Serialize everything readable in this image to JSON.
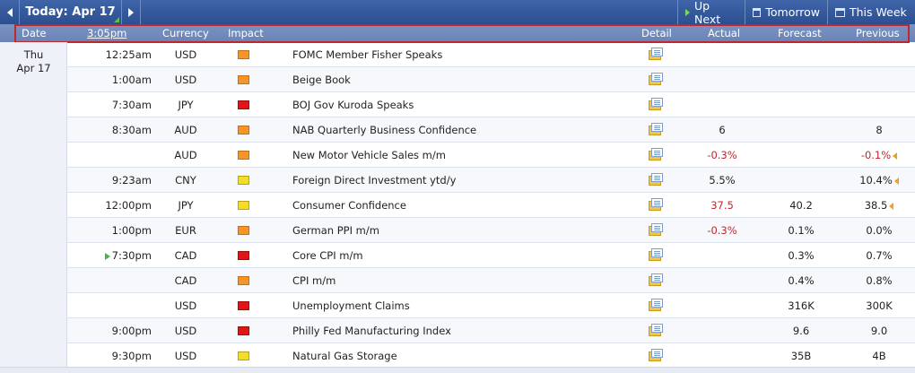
{
  "nav": {
    "today_label": "Today: Apr 17",
    "up_next": "Up Next",
    "tomorrow": "Tomorrow",
    "this_week": "This Week"
  },
  "header": {
    "date": "Date",
    "time": "3:05pm",
    "currency": "Currency",
    "impact": "Impact",
    "detail": "Detail",
    "actual": "Actual",
    "forecast": "Forecast",
    "previous": "Previous"
  },
  "date_group": {
    "weekday": "Thu",
    "date": "Apr 17"
  },
  "colors": {
    "high_impact": "#e01616",
    "medium_impact": "#f5962a",
    "low_impact": "#f5dc2a",
    "negative": "#c0272d",
    "accent": "#2c4f90"
  },
  "events": [
    {
      "time": "12:25am",
      "currency": "USD",
      "impact": "orange",
      "event": "FOMC Member Fisher Speaks",
      "actual": "",
      "forecast": "",
      "previous": ""
    },
    {
      "time": "1:00am",
      "currency": "USD",
      "impact": "orange",
      "event": "Beige Book",
      "actual": "",
      "forecast": "",
      "previous": ""
    },
    {
      "time": "7:30am",
      "currency": "JPY",
      "impact": "red",
      "event": "BOJ Gov Kuroda Speaks",
      "actual": "",
      "forecast": "",
      "previous": ""
    },
    {
      "time": "8:30am",
      "currency": "AUD",
      "impact": "orange",
      "event": "NAB Quarterly Business Confidence",
      "actual": "6",
      "forecast": "",
      "previous": "8"
    },
    {
      "time": "",
      "currency": "AUD",
      "impact": "orange",
      "event": "New Motor Vehicle Sales m/m",
      "actual": "-0.3%",
      "forecast": "",
      "previous": "-0.1%"
    },
    {
      "time": "9:23am",
      "currency": "CNY",
      "impact": "yellow",
      "event": "Foreign Direct Investment ytd/y",
      "actual": "5.5%",
      "forecast": "",
      "previous": "10.4%"
    },
    {
      "time": "12:00pm",
      "currency": "JPY",
      "impact": "yellow",
      "event": "Consumer Confidence",
      "actual": "37.5",
      "forecast": "40.2",
      "previous": "38.5"
    },
    {
      "time": "1:00pm",
      "currency": "EUR",
      "impact": "orange",
      "event": "German PPI m/m",
      "actual": "-0.3%",
      "forecast": "0.1%",
      "previous": "0.0%"
    },
    {
      "time": "7:30pm",
      "currency": "CAD",
      "impact": "red",
      "event": "Core CPI m/m",
      "actual": "",
      "forecast": "0.3%",
      "previous": "0.7%"
    },
    {
      "time": "",
      "currency": "CAD",
      "impact": "orange",
      "event": "CPI m/m",
      "actual": "",
      "forecast": "0.4%",
      "previous": "0.8%"
    },
    {
      "time": "",
      "currency": "USD",
      "impact": "red",
      "event": "Unemployment Claims",
      "actual": "",
      "forecast": "316K",
      "previous": "300K"
    },
    {
      "time": "9:00pm",
      "currency": "USD",
      "impact": "red",
      "event": "Philly Fed Manufacturing Index",
      "actual": "",
      "forecast": "9.6",
      "previous": "9.0"
    },
    {
      "time": "9:30pm",
      "currency": "USD",
      "impact": "yellow",
      "event": "Natural Gas Storage",
      "actual": "",
      "forecast": "35B",
      "previous": "4B"
    }
  ]
}
